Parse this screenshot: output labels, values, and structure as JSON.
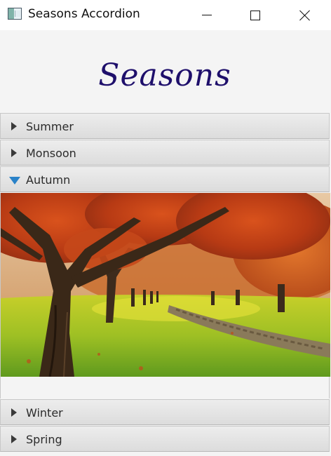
{
  "window": {
    "title": "Seasons Accordion"
  },
  "header": {
    "title": "Seasons"
  },
  "accordion": {
    "panes": [
      {
        "label": "Summer",
        "expanded": false
      },
      {
        "label": "Monsoon",
        "expanded": false
      },
      {
        "label": "Autumn",
        "expanded": true
      },
      {
        "label": "Winter",
        "expanded": false
      },
      {
        "label": "Spring",
        "expanded": false
      }
    ]
  },
  "icons": {
    "collapsed": "triangle-right-icon",
    "expanded": "triangle-down-icon"
  },
  "colors": {
    "header_title": "#1e0f6b",
    "expanded_arrow": "#2a82c8",
    "pane_header_bg": "#e4e4e4"
  }
}
